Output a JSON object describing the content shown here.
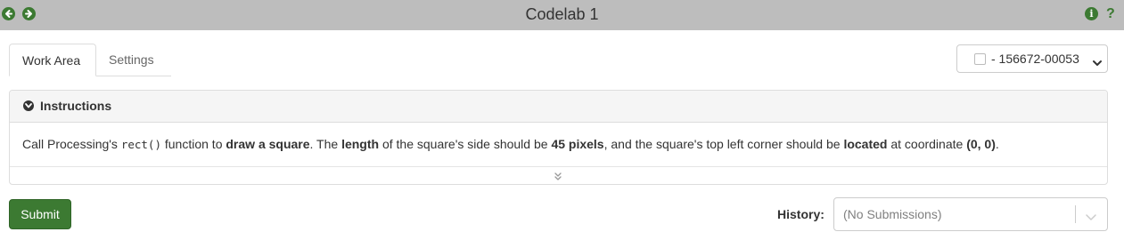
{
  "window": {
    "title": "Codelab 1",
    "nav_icons": [
      "back-arrow-icon",
      "forward-arrow-icon"
    ],
    "help_icons": [
      "info-icon",
      "question-icon"
    ],
    "info_glyph": "i",
    "question_glyph": "?",
    "accent_color": "#3c7a32",
    "titlebar_color": "#bdbdbd"
  },
  "tabs": [
    {
      "label": "Work Area",
      "active": true
    },
    {
      "label": "Settings",
      "active": false
    }
  ],
  "problem_select": {
    "value": "- 156672-00053"
  },
  "instructions": {
    "heading": "Instructions",
    "body": {
      "t1": "Call Processing's ",
      "code": "rect()",
      "t2": " function to ",
      "b1": "draw a square",
      "t3": ".  The ",
      "b2": "length",
      "t4": " of the square's side should be ",
      "b3": "45 pixels",
      "t5": ", and the square's top left corner should be ",
      "b4": "located",
      "t6": " at coordinate ",
      "b5": "(0, 0)",
      "t7": "."
    }
  },
  "actions": {
    "submit_label": "Submit",
    "history_label": "History:",
    "history_value": "(No Submissions)"
  }
}
